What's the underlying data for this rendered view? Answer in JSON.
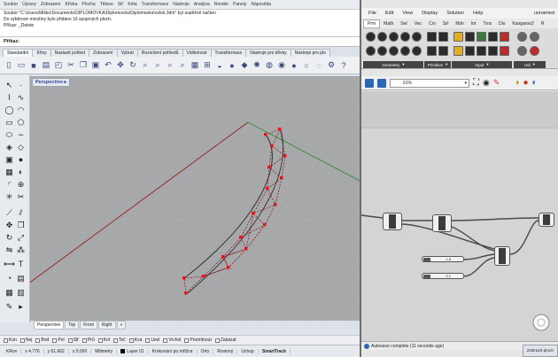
{
  "rhino": {
    "menu": [
      "Soubor",
      "Úpravy",
      "Zobrazení",
      "Křivka",
      "Plocha",
      "Těleso",
      "Síť",
      "Kóta",
      "Transformace",
      "Nástroje",
      "Analýza",
      "Render",
      "Panely",
      "Nápověda"
    ],
    "command_history": [
      "Soubor \"C:\\Users\\Miško\\Documents\\DIPLOMOVKA\\Diplomovka\\Diplomovka\\celok.3dm\" byl úspěšně načten",
      "Do výběrové množiny bylo přidáno 16 spojených ploch.",
      "Příkaz: _Delete"
    ],
    "command_prompt": "Příkaz:",
    "toolbar_tabs": [
      "Standardní",
      "Křivy",
      "Nastavit pohled",
      "Zobrazení",
      "Vybrat",
      "Rozvržení pohledů",
      "Viditelnost",
      "Transformace",
      "Nástroje pro křivky",
      "Nástroje pro plo"
    ],
    "active_toolbar_tab": "Standardní",
    "viewport_label": "Perspective ▸",
    "viewport_tabs": [
      "Perspective",
      "Top",
      "Front",
      "Right",
      "+"
    ],
    "osnap": [
      "Kon",
      "Nej",
      "Bod",
      "Pol",
      "Stř",
      "Prů",
      "Kol",
      "Teč",
      "Kva",
      "Uzel",
      "Vrchol",
      "Promítnout",
      "Zakázat"
    ],
    "status": {
      "plane": "KRov",
      "x": "x 4.776",
      "y": "y 61.662",
      "z": "z 0.000",
      "units": "Milimetry",
      "layer": "Layer 01",
      "grid_snap": "Krokování po mřížce",
      "ortho": "Orto",
      "planar": "Rovinný",
      "osnap": "Uchop",
      "smarttrack": "SmartTrack"
    },
    "colors": {
      "viewport_bg": "#a7a9ab",
      "x_axis": "#9b1c1c",
      "y_axis": "#2f8a2f",
      "curve_points": "#e0171f"
    }
  },
  "grasshopper": {
    "menu": [
      "File",
      "Edit",
      "View",
      "Display",
      "Solution",
      "Help"
    ],
    "document": "unnamed",
    "tabs": [
      "Prm",
      "Math",
      "Set",
      "Vec",
      "Crv",
      "Srf",
      "Msh",
      "Int",
      "Trns",
      "Dis",
      "Kangaroo2",
      "R"
    ],
    "active_tab": "Prm",
    "ribbon_groups": [
      "Geometry",
      "Primitive",
      "Input",
      "Util"
    ],
    "zoom": "61%",
    "status": "Autosave complete (11 seconds ago)",
    "sliders": [
      {
        "value": "1.5"
      },
      {
        "value": "0.1"
      }
    ]
  },
  "smart_button": "Zobrazit ploch"
}
